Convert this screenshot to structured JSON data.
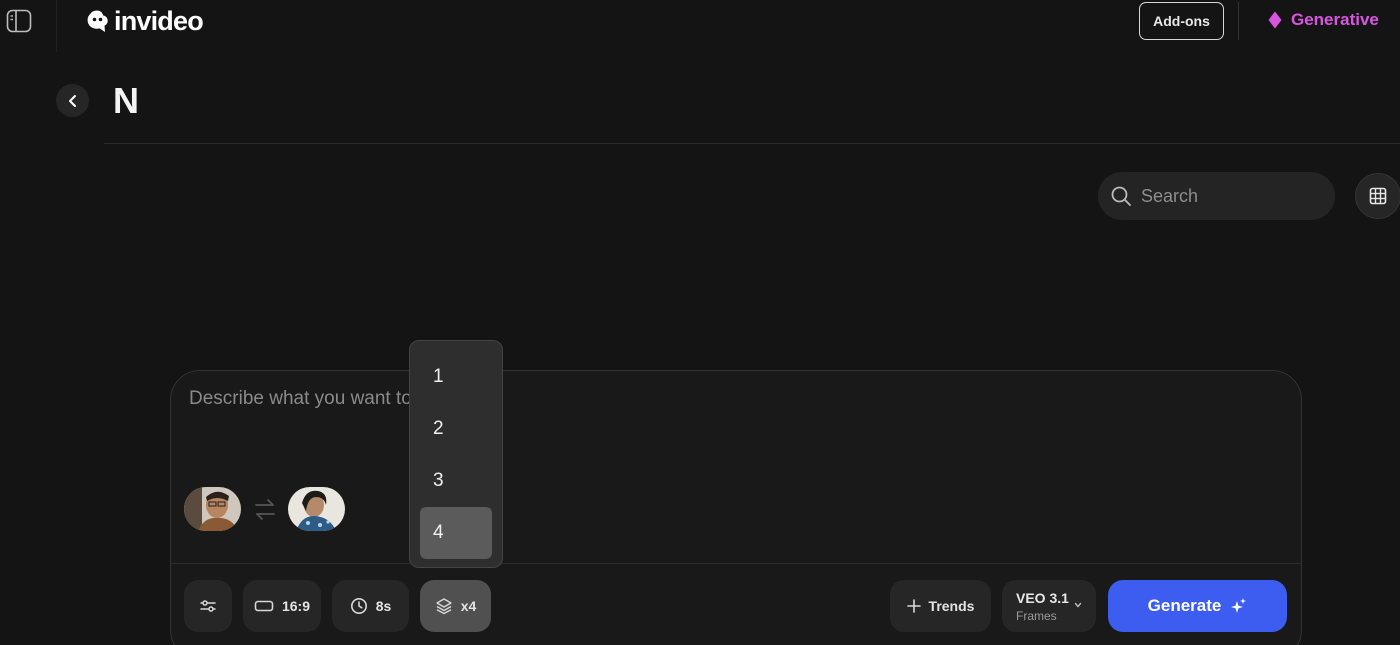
{
  "app": {
    "logo_text": "invideo",
    "addons_label": "Add-ons",
    "plan_label": "Generative"
  },
  "header": {
    "title": "N"
  },
  "search": {
    "placeholder": "Search"
  },
  "composer": {
    "prompt_placeholder": "Describe what you want to create...",
    "aspect_ratio": "16:9",
    "duration": "8s",
    "count": "x4",
    "trends_label": "Trends",
    "model_name": "VEO 3.1",
    "model_mode": "Frames",
    "generate_label": "Generate"
  },
  "count_dropdown": {
    "options": [
      "1",
      "2",
      "3",
      "4"
    ],
    "selected": "4"
  },
  "colors": {
    "accent": "#3d5cf0",
    "plan": "#d955e0",
    "background": "#141414"
  }
}
